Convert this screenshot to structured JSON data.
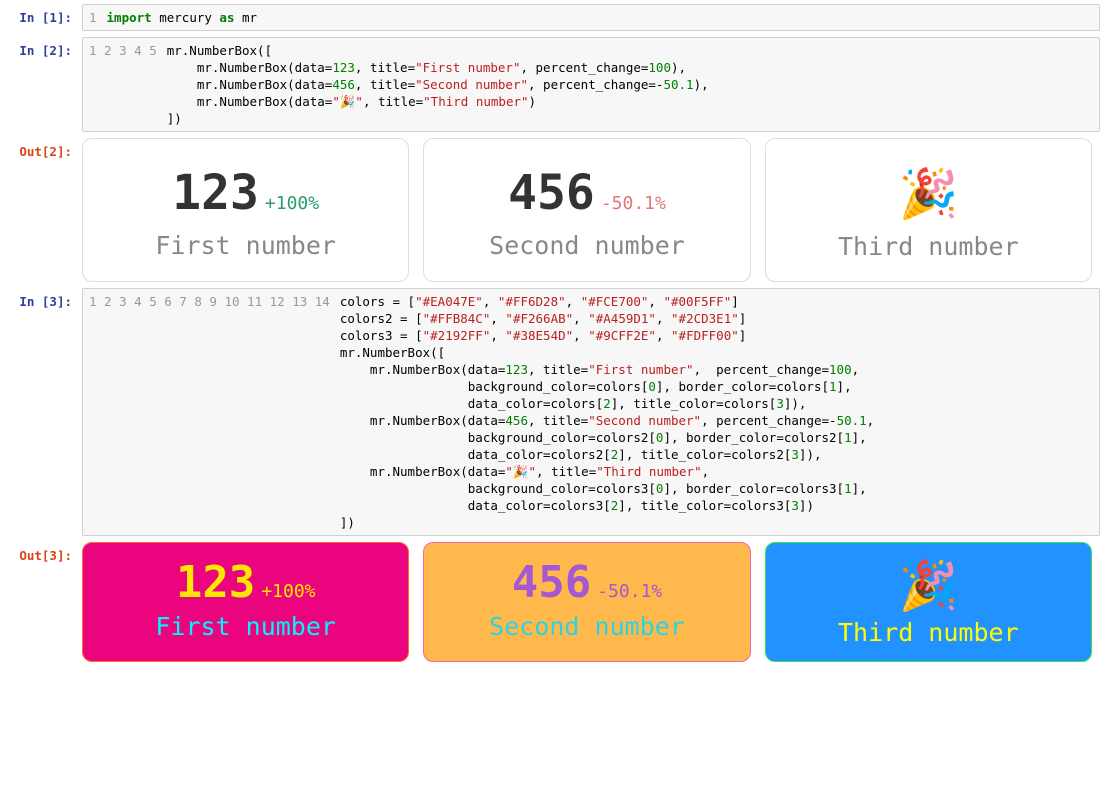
{
  "prompts": {
    "in1": "In [1]:",
    "in2": "In [2]:",
    "out2": "Out[2]:",
    "in3": "In [3]:",
    "out3": "Out[3]:"
  },
  "cell1": {
    "line1_kw1": "import",
    "line1_mid": " mercury ",
    "line1_kw2": "as",
    "line1_end": " mr"
  },
  "cell2": {
    "l1": "mr.NumberBox([",
    "l2a": "    mr.NumberBox(data=",
    "l2n": "123",
    "l2b": ", title=",
    "l2s": "\"First number\"",
    "l2c": ", percent_change=",
    "l2n2": "100",
    "l2d": "),",
    "l3a": "    mr.NumberBox(data=",
    "l3n": "456",
    "l3b": ", title=",
    "l3s": "\"Second number\"",
    "l3c": ", percent_change=-",
    "l3n2": "50.1",
    "l3d": "),",
    "l4a": "    mr.NumberBox(data=",
    "l4s1": "\"🎉\"",
    "l4b": ", title=",
    "l4s2": "\"Third number\"",
    "l4c": ")",
    "l5": "])"
  },
  "out2": {
    "box1": {
      "data": "123",
      "pct": "+100%",
      "title": "First number"
    },
    "box2": {
      "data": "456",
      "pct": "-50.1%",
      "title": "Second number"
    },
    "box3": {
      "data": "🎉",
      "title": "Third number"
    }
  },
  "cell3": {
    "l1a": "colors = [",
    "l1s1": "\"#EA047E\"",
    "l1c": ", ",
    "l1s2": "\"#FF6D28\"",
    "l1s3": "\"#FCE700\"",
    "l1s4": "\"#00F5FF\"",
    "l1z": "]",
    "l2a": "colors2 = [",
    "l2s1": "\"#FFB84C\"",
    "l2s2": "\"#F266AB\"",
    "l2s3": "\"#A459D1\"",
    "l2s4": "\"#2CD3E1\"",
    "l3a": "colors3 = [",
    "l3s1": "\"#2192FF\"",
    "l3s2": "\"#38E54D\"",
    "l3s3": "\"#9CFF2E\"",
    "l3s4": "\"#FDFF00\"",
    "l4": "mr.NumberBox([",
    "l5a": "    mr.NumberBox(data=",
    "l5n": "123",
    "l5b": ", title=",
    "l5s": "\"First number\"",
    "l5c": ",  percent_change=",
    "l5n2": "100",
    "l5d": ",",
    "l6a": "                 background_color=colors[",
    "l6n0": "0",
    "l6b": "], border_color=colors[",
    "l6n1": "1",
    "l6c": "],",
    "l7a": "                 data_color=colors[",
    "l7n2": "2",
    "l7b": "], title_color=colors[",
    "l7n3": "3",
    "l7c": "]),",
    "l8a": "    mr.NumberBox(data=",
    "l8n": "456",
    "l8b": ", title=",
    "l8s": "\"Second number\"",
    "l8c": ", percent_change=-",
    "l8n2": "50.1",
    "l8d": ",",
    "l9a": "                 background_color=colors2[",
    "l9n0": "0",
    "l9b": "], border_color=colors2[",
    "l9n1": "1",
    "l9c": "],",
    "l10a": "                 data_color=colors2[",
    "l10n2": "2",
    "l10b": "], title_color=colors2[",
    "l10n3": "3",
    "l10c": "]),",
    "l11a": "    mr.NumberBox(data=",
    "l11s1": "\"🎉\"",
    "l11b": ", title=",
    "l11s2": "\"Third number\"",
    "l11c": ",",
    "l12a": "                 background_color=colors3[",
    "l12n0": "0",
    "l12b": "], border_color=colors3[",
    "l12n1": "1",
    "l12c": "],",
    "l13a": "                 data_color=colors3[",
    "l13n2": "2",
    "l13b": "], title_color=colors3[",
    "l13n3": "3",
    "l13c": "])",
    "l14": "])"
  },
  "out3": {
    "box1": {
      "data": "123",
      "pct": "+100%",
      "title": "First number"
    },
    "box2": {
      "data": "456",
      "pct": "-50.1%",
      "title": "Second number"
    },
    "box3": {
      "data": "🎉",
      "title": "Third number"
    }
  },
  "gutters": {
    "g1": "1",
    "g5": "1\n2\n3\n4\n5",
    "g14": "1\n2\n3\n4\n5\n6\n7\n8\n9\n10\n11\n12\n13\n14"
  }
}
